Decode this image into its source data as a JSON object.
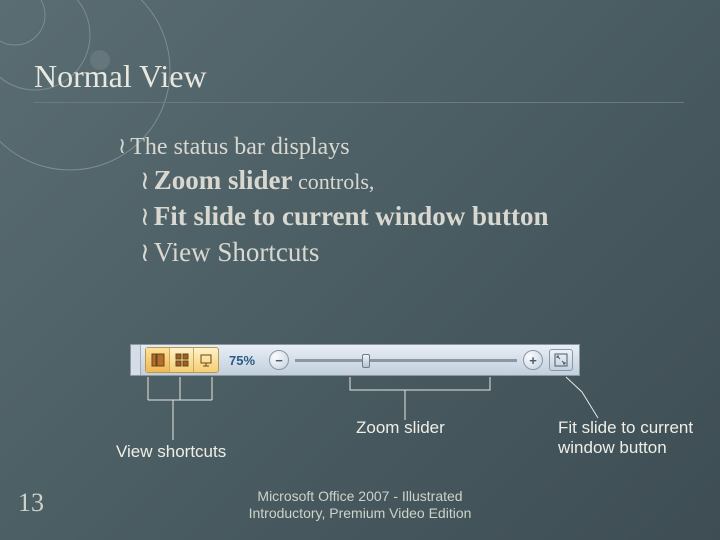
{
  "title": "Normal View",
  "bullet1": "The status bar displays",
  "sub": {
    "a_bold": "Zoom slider",
    "a_rest": " controls,",
    "b": "Fit slide to current window button",
    "c": "View Shortcuts"
  },
  "statusbar": {
    "zoom_pct": "75%",
    "minus": "−",
    "plus": "+"
  },
  "labels": {
    "zoom": "Zoom slider",
    "shortcuts": "View shortcuts",
    "fit": "Fit slide to current window button"
  },
  "slidenum": "13",
  "footer_l1": "Microsoft Office 2007 - Illustrated",
  "footer_l2": "Introductory, Premium Video Edition",
  "bullet_sym": "≀"
}
